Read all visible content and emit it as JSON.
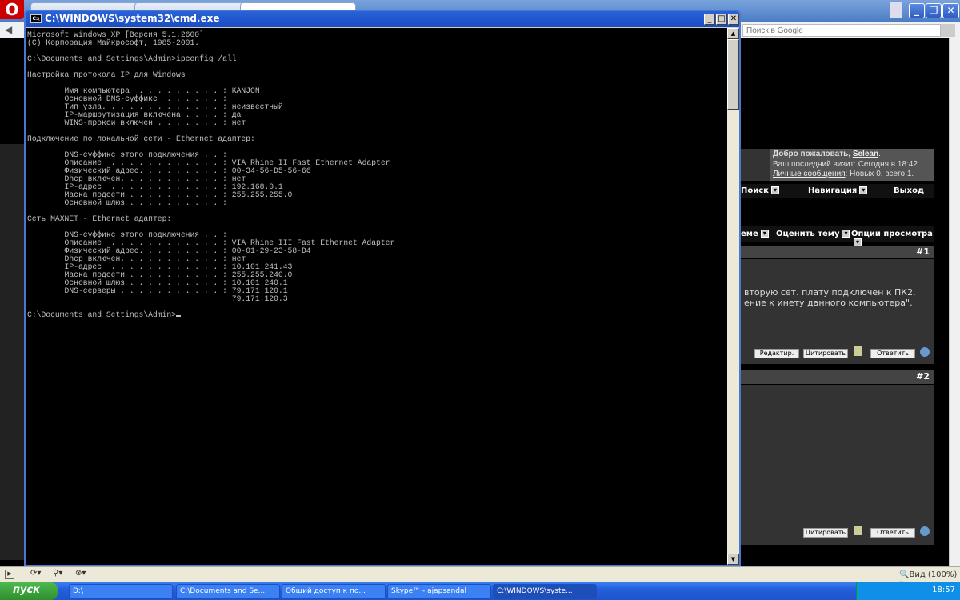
{
  "browser": {
    "search_placeholder": "Поиск в Google",
    "zoom_label": "Вид (100%)"
  },
  "forum": {
    "welcome_prefix": "Добро пожаловать, ",
    "username": "Selean",
    "last_visit": "Ваш последний визит: Сегодня в 18:42",
    "pm_link": "Личные сообщения",
    "pm_counts": ": Новых 0, всего 1.",
    "nav": [
      "Поиск",
      "Навигация",
      "Выход"
    ],
    "thread_tools": [
      "еме",
      "Оценить тему",
      "Опции просмотра"
    ],
    "posts": [
      {
        "number": "#1",
        "lines": [
          "вторую сет. плату подключен к ПК2.",
          "ение к инету данного компьютера\"."
        ],
        "buttons": [
          "Редактир.",
          "Цитировать",
          "Ответить"
        ]
      },
      {
        "number": "#2",
        "lines": [],
        "buttons": [
          "Цитировать",
          "Ответить"
        ]
      }
    ]
  },
  "cmd": {
    "title": "C:\\WINDOWS\\system32\\cmd.exe",
    "lines": [
      "Microsoft Windows XP [Версия 5.1.2600]",
      "(C) Корпорация Майкрософт, 1985-2001.",
      "",
      "C:\\Documents and Settings\\Admin>ipconfig /all",
      "",
      "Настройка протокола IP для Windows",
      "",
      "        Имя компьютера  . . . . . . . . . : KANJON",
      "        Основной DNS-суффикс  . . . . . . :",
      "        Тип узла. . . . . . . . . . . . . : неизвестный",
      "        IP-маршрутизация включена . . . . : да",
      "        WINS-прокси включен . . . . . . . : нет",
      "",
      "Подключение по локальной сети - Ethernet адаптер:",
      "",
      "        DNS-суффикс этого подключения . . :",
      "        Описание  . . . . . . . . . . . . : VIA Rhine II Fast Ethernet Adapter",
      "        Физический адрес. . . . . . . . . : 00-34-56-D5-56-66",
      "        Dhcp включен. . . . . . . . . . . : нет",
      "        IP-адрес  . . . . . . . . . . . . : 192.168.0.1",
      "        Маска подсети . . . . . . . . . . : 255.255.255.0",
      "        Основной шлюз . . . . . . . . . . :",
      "",
      "Сеть MAXNET - Ethernet адаптер:",
      "",
      "        DNS-суффикс этого подключения . . :",
      "        Описание  . . . . . . . . . . . . : VIA Rhine III Fast Ethernet Adapter",
      "        Физический адрес. . . . . . . . . : 00-01-29-23-58-D4",
      "        Dhcp включен. . . . . . . . . . . : нет",
      "        IP-адрес  . . . . . . . . . . . . : 10.101.241.43",
      "        Маска подсети . . . . . . . . . . : 255.255.240.0",
      "        Основной шлюз . . . . . . . . . . : 10.101.240.1",
      "        DNS-серверы . . . . . . . . . . . : 79.171.120.1",
      "                                            79.171.120.3",
      ""
    ],
    "prompt": "C:\\Documents and Settings\\Admin>"
  },
  "taskbar": {
    "start": "пуск",
    "tasks": [
      "D:\\",
      "C:\\Documents and Se...",
      "Общий доступ к по...",
      "Skype™ - ajapsandal",
      "C:\\WINDOWS\\syste..."
    ],
    "clock": "18:57"
  }
}
